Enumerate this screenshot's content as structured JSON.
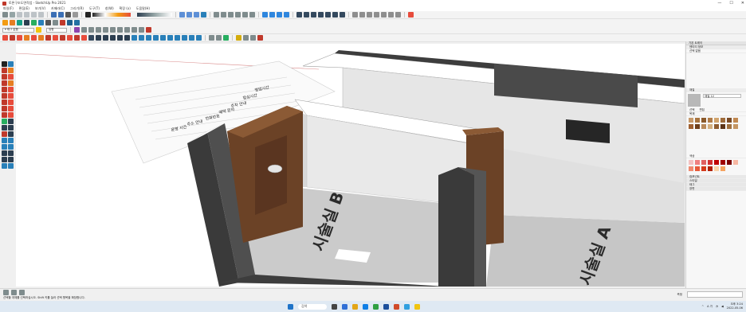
{
  "window": {
    "title": "토론구조도면작업 - SketchUp Pro 2021",
    "controls": [
      "—",
      "☐",
      "✕"
    ]
  },
  "menu": {
    "items": [
      "파일(F)",
      "편집(E)",
      "보기(V)",
      "카메라(C)",
      "그리기(R)",
      "도구(T)",
      "창(W)",
      "확장 (x)",
      "도움말(H)"
    ]
  },
  "toolbar": {
    "layer_dropdown": "▾ 태그 없음",
    "style_dropdown": "유형"
  },
  "model": {
    "room_b_label": "시술실 B",
    "room_a_label": "시술실 A",
    "text_lines": [
      "영업시간",
      "점심시간",
      "주차 안내",
      "예약 문의",
      "전화번호",
      "주소 안내",
      "운영 시간"
    ]
  },
  "tray": {
    "header": "기본 트레이",
    "entity_info_title": "엔티티 정보",
    "entity_info_value": "선택 없음",
    "materials_title": "재질",
    "material_name": "재질 12",
    "tab_select": "선택",
    "tab_edit": "편집",
    "library_label": "목재",
    "library2_label": "색상",
    "sections": [
      "컴포넌트",
      "스타일",
      "태그",
      "장면"
    ]
  },
  "statusbar": {
    "hint": "선택할 개체를 선택하십시오. Shift 키를 눌러 선택 항목을 확장합니다.",
    "measurements_label": "측정"
  },
  "taskbar": {
    "search": "검색",
    "time": "오후 3:24",
    "date": "2022-05-06",
    "lang": "A 가"
  },
  "colors": {
    "wood": "#6b4226",
    "dark_wall": "#3a3a3a",
    "floor": "#c8c8c8",
    "wall_top": "#ffffff",
    "wall_face": "#e3e3e3"
  }
}
